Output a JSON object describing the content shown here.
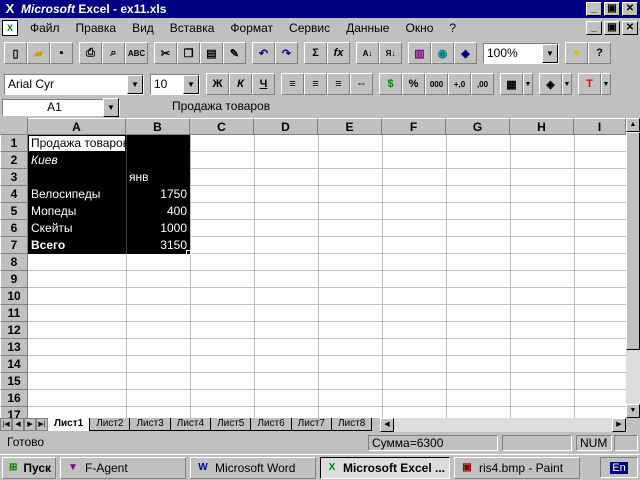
{
  "window": {
    "app_name": "Microsoft",
    "title_rest": " Excel - ex11.xls"
  },
  "menu": [
    "Файл",
    "Правка",
    "Вид",
    "Вставка",
    "Формат",
    "Сервис",
    "Данные",
    "Окно",
    "?"
  ],
  "toolbar": {
    "zoom": "100%",
    "font_name": "Arial Cyr",
    "font_size": "10",
    "bold": "Ж",
    "italic": "К",
    "underline": "Ч",
    "percent": "%",
    "thousands": "000",
    "inc_decimal": "+,0",
    "dec_decimal": ",00",
    "sum": "Σ",
    "function": "fx"
  },
  "formula_bar": {
    "name_box": "A1",
    "content": "Продажа товаров"
  },
  "columns": [
    "A",
    "B",
    "C",
    "D",
    "E",
    "F",
    "G",
    "H",
    "I"
  ],
  "rows": [
    "1",
    "2",
    "3",
    "4",
    "5",
    "6",
    "7",
    "8",
    "9",
    "10",
    "11",
    "12",
    "13",
    "14",
    "15",
    "16",
    "17"
  ],
  "cells": {
    "a1": "Продажа товаров",
    "a2": "Киев",
    "b3": "янв",
    "a4": "Велосипеды",
    "b4": "1750",
    "a5": "Мопеды",
    "b5": "400",
    "a6": "Скейты",
    "b6": "1000",
    "a7": "Всего",
    "b7": "3150"
  },
  "sheets": [
    "Лист1",
    "Лист2",
    "Лист3",
    "Лист4",
    "Лист5",
    "Лист6",
    "Лист7",
    "Лист8"
  ],
  "status": {
    "ready": "Готово",
    "sum": "Сумма=6300",
    "num": "NUM"
  },
  "taskbar": {
    "start": "Пуск",
    "items": [
      "F-Agent",
      "Microsoft Word",
      "Microsoft Excel ...",
      "ris4.bmp - Paint"
    ],
    "tray": "En"
  }
}
